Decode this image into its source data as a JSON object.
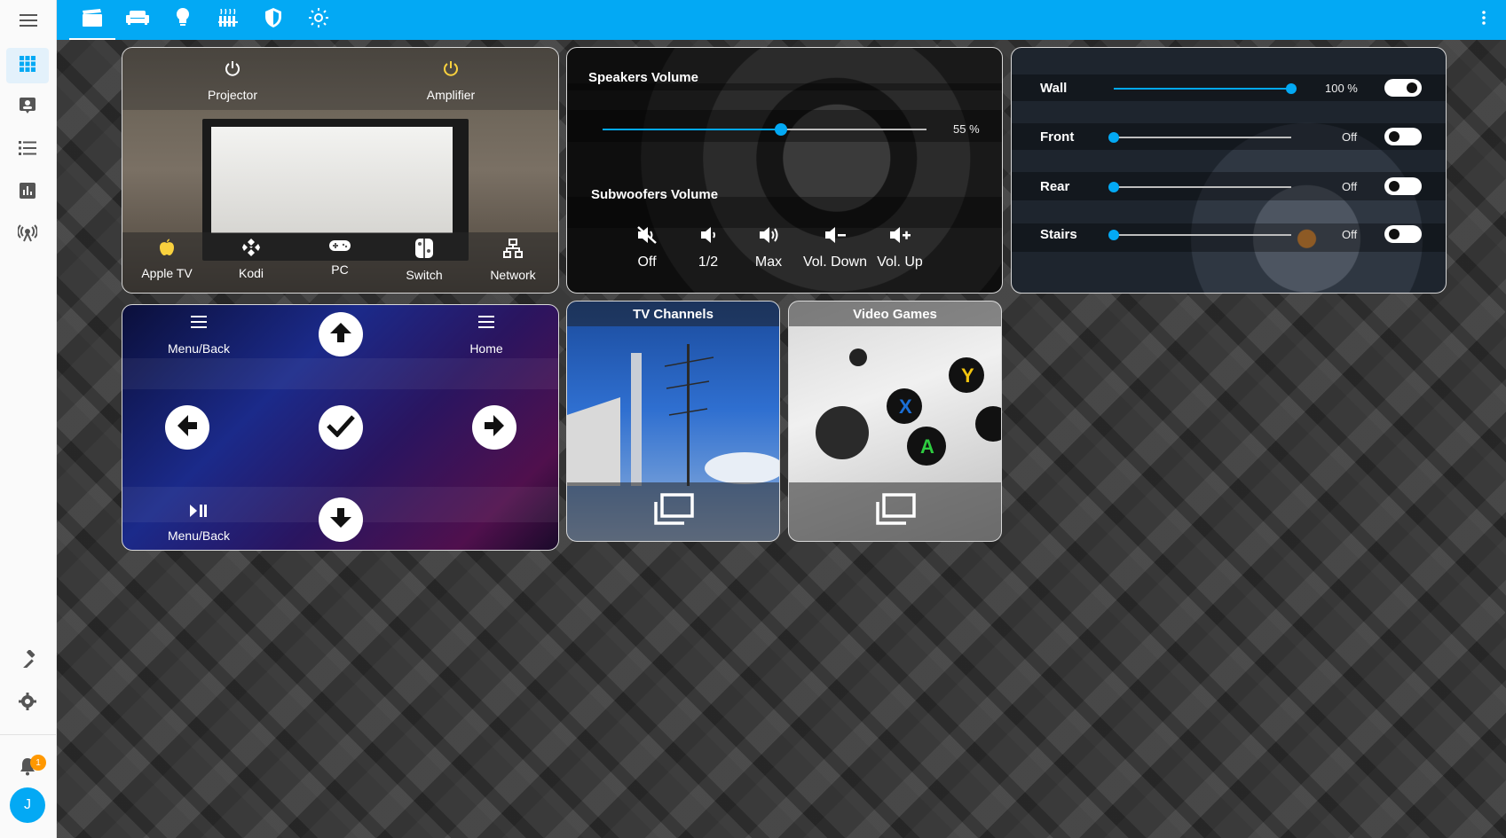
{
  "colors": {
    "accent": "#03a9f4",
    "badge": "#ff9800",
    "amplifier_on": "#f9d13e",
    "apple_icon": "#f9d13e"
  },
  "sidebar": {
    "items": [
      {
        "icon": "dashboard-icon"
      },
      {
        "icon": "account-box-icon"
      },
      {
        "icon": "list-icon"
      },
      {
        "icon": "chart-icon"
      },
      {
        "icon": "radio-tower-icon"
      },
      {
        "icon": "hammer-icon"
      },
      {
        "icon": "gear-icon"
      }
    ],
    "notification_count": "1",
    "avatar_initial": "J"
  },
  "topbar": {
    "tabs": [
      {
        "icon": "movie-icon"
      },
      {
        "icon": "sofa-icon"
      },
      {
        "icon": "lightbulb-icon"
      },
      {
        "icon": "radiator-icon"
      },
      {
        "icon": "shield-icon"
      },
      {
        "icon": "sun-icon"
      }
    ]
  },
  "projector_card": {
    "top_buttons": [
      "Projector",
      "Amplifier"
    ],
    "sources": [
      "Apple TV",
      "Kodi",
      "PC",
      "Switch",
      "Network"
    ]
  },
  "speakers_card": {
    "speakers_title": "Speakers Volume",
    "speakers_value": "55 %",
    "speakers_level": 0.55,
    "subwoofers_title": "Subwoofers Volume",
    "buttons": [
      "Off",
      "1/2",
      "Max",
      "Vol. Down",
      "Vol. Up"
    ]
  },
  "lights_card": {
    "rows": [
      {
        "name": "Wall",
        "value": "100 %",
        "level": 1.0,
        "on": true
      },
      {
        "name": "Front",
        "value": "Off",
        "level": 0.0,
        "on": false
      },
      {
        "name": "Rear",
        "value": "Off",
        "level": 0.0,
        "on": false
      },
      {
        "name": "Stairs",
        "value": "Off",
        "level": 0.0,
        "on": false
      }
    ]
  },
  "remote_card": {
    "menu_back_top": "Menu/Back",
    "home": "Home",
    "menu_back_bottom": "Menu/Back"
  },
  "tiles": {
    "tv_channels": "TV Channels",
    "video_games": "Video Games"
  }
}
